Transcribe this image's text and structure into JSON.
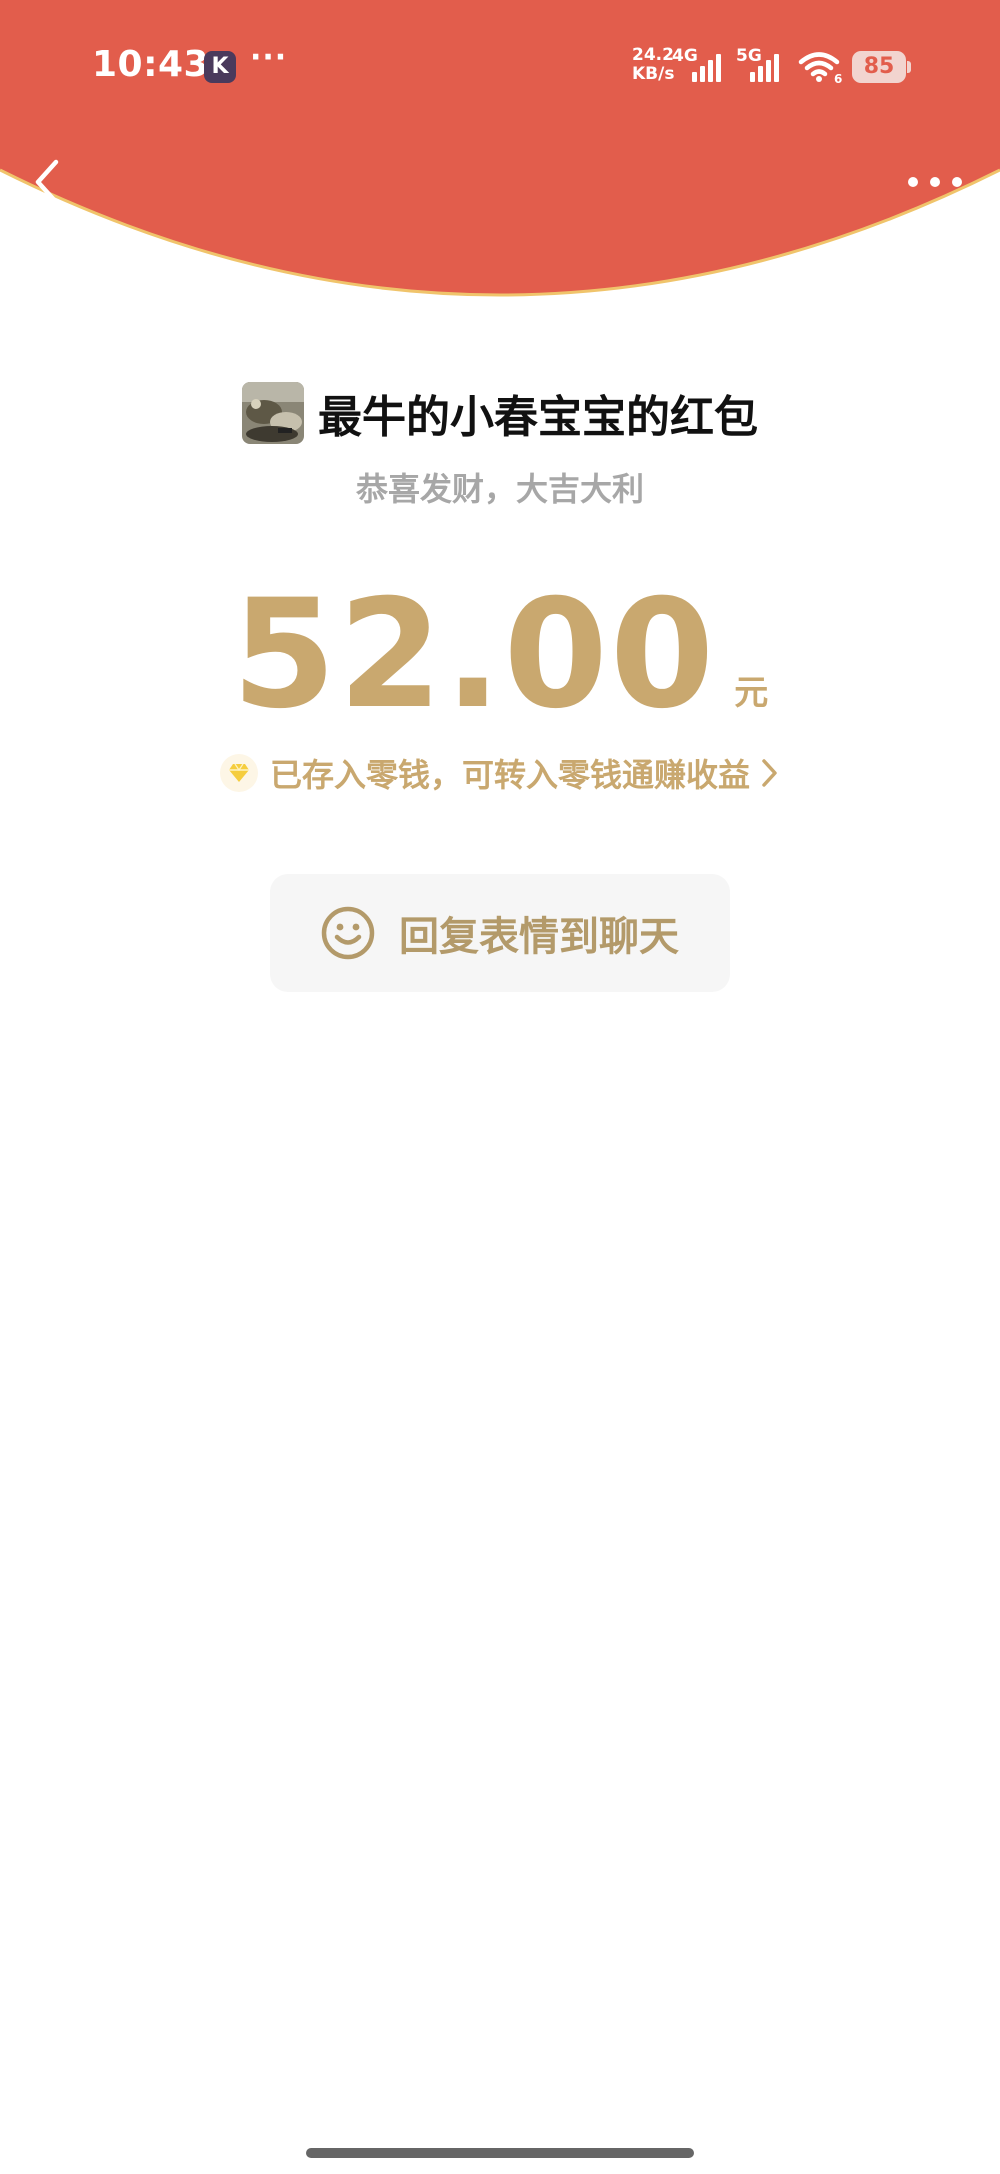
{
  "status_bar": {
    "time": "10:43",
    "app_badge": "K",
    "more_dots": "···",
    "net_speed_value": "24.2",
    "net_speed_unit": "KB/s",
    "net_4g": "4G",
    "net_5g": "5G",
    "wifi_sub": "6",
    "battery": "85"
  },
  "header": {
    "back_icon": "chevron-left-icon",
    "more_icon": "more-horizontal-icon"
  },
  "red_packet": {
    "sender_title": "最牛的小春宝宝的红包",
    "blessing": "恭喜发财，大吉大利",
    "amount": "52.00",
    "currency": "元",
    "wallet_note": "已存入零钱，可转入零钱通赚收益",
    "reply_label": "回复表情到聊天"
  },
  "colors": {
    "header_red": "#e25d4c",
    "header_edge": "#f0c46b",
    "gold": "#c9a86f"
  }
}
